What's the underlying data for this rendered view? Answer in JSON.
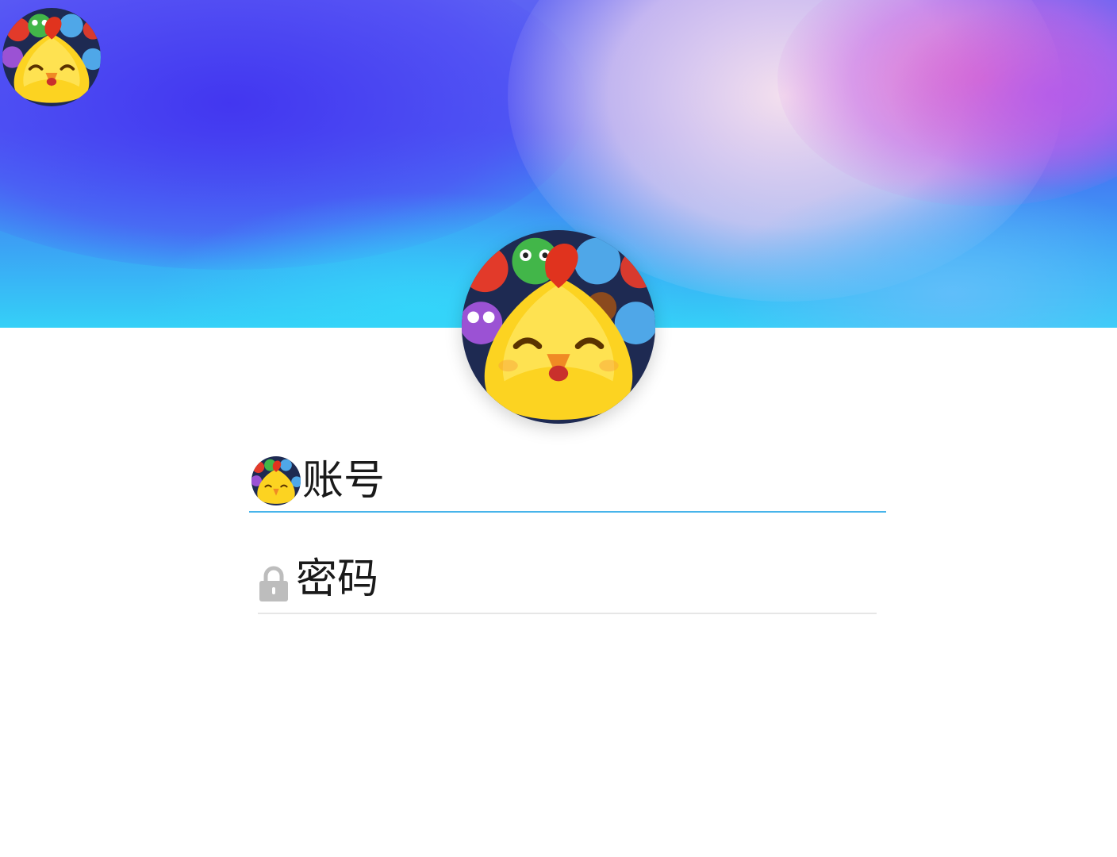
{
  "login": {
    "account_placeholder": "账号",
    "password_placeholder": "密码"
  },
  "icons": {
    "avatar": "game-chick-avatar-icon",
    "password_field": "lock-icon"
  },
  "colors": {
    "banner_blue": "#4a63f2",
    "banner_cyan": "#35d0f7",
    "banner_pink": "#ec6ec8",
    "active_underline": "#48b4ea",
    "inactive_underline": "#e6e6e6"
  }
}
